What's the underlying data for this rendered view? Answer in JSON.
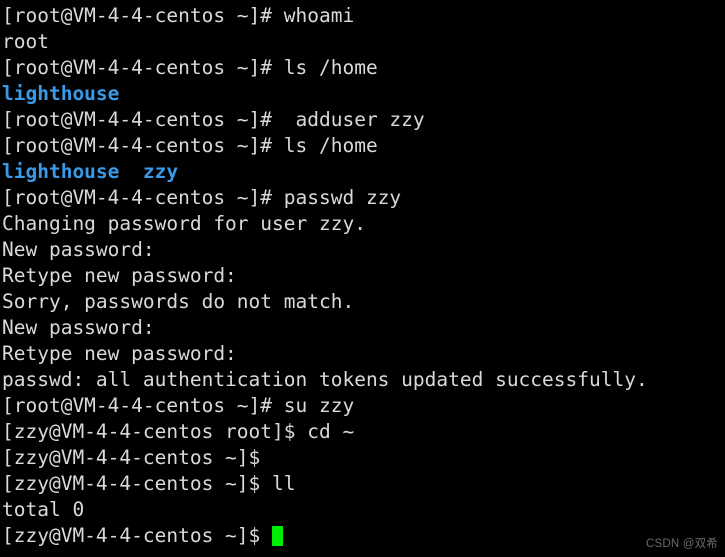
{
  "terminal": {
    "background_color": "#000000",
    "foreground_color": "#d9d9d9",
    "directory_color": "#3b9ae8",
    "cursor_color": "#00ec00",
    "lines": [
      {
        "segments": [
          {
            "text": "[root@VM-4-4-centos ~]# whoami",
            "style": "default"
          }
        ]
      },
      {
        "segments": [
          {
            "text": "root",
            "style": "default"
          }
        ]
      },
      {
        "segments": [
          {
            "text": "[root@VM-4-4-centos ~]# ls /home",
            "style": "default"
          }
        ]
      },
      {
        "segments": [
          {
            "text": "lighthouse",
            "style": "dir"
          }
        ]
      },
      {
        "segments": [
          {
            "text": "[root@VM-4-4-centos ~]#  adduser zzy",
            "style": "default"
          }
        ]
      },
      {
        "segments": [
          {
            "text": "[root@VM-4-4-centos ~]# ls /home",
            "style": "default"
          }
        ]
      },
      {
        "segments": [
          {
            "text": "lighthouse",
            "style": "dir"
          },
          {
            "text": "  ",
            "style": "default"
          },
          {
            "text": "zzy",
            "style": "dir"
          }
        ]
      },
      {
        "segments": [
          {
            "text": "[root@VM-4-4-centos ~]# passwd zzy",
            "style": "default"
          }
        ]
      },
      {
        "segments": [
          {
            "text": "Changing password for user zzy.",
            "style": "default"
          }
        ]
      },
      {
        "segments": [
          {
            "text": "New password:",
            "style": "default"
          }
        ]
      },
      {
        "segments": [
          {
            "text": "Retype new password:",
            "style": "default"
          }
        ]
      },
      {
        "segments": [
          {
            "text": "Sorry, passwords do not match.",
            "style": "default"
          }
        ]
      },
      {
        "segments": [
          {
            "text": "New password:",
            "style": "default"
          }
        ]
      },
      {
        "segments": [
          {
            "text": "Retype new password:",
            "style": "default"
          }
        ]
      },
      {
        "segments": [
          {
            "text": "passwd: all authentication tokens updated successfully.",
            "style": "default"
          }
        ]
      },
      {
        "segments": [
          {
            "text": "[root@VM-4-4-centos ~]# su zzy",
            "style": "default"
          }
        ]
      },
      {
        "segments": [
          {
            "text": "[zzy@VM-4-4-centos root]$ cd ~",
            "style": "default"
          }
        ]
      },
      {
        "segments": [
          {
            "text": "[zzy@VM-4-4-centos ~]$",
            "style": "default"
          }
        ]
      },
      {
        "segments": [
          {
            "text": "[zzy@VM-4-4-centos ~]$ ll",
            "style": "default"
          }
        ]
      },
      {
        "segments": [
          {
            "text": "total 0",
            "style": "default"
          }
        ]
      },
      {
        "segments": [
          {
            "text": "[zzy@VM-4-4-centos ~]$ ",
            "style": "default"
          }
        ],
        "cursor": true
      }
    ]
  },
  "watermark": {
    "text": "CSDN @双希"
  }
}
